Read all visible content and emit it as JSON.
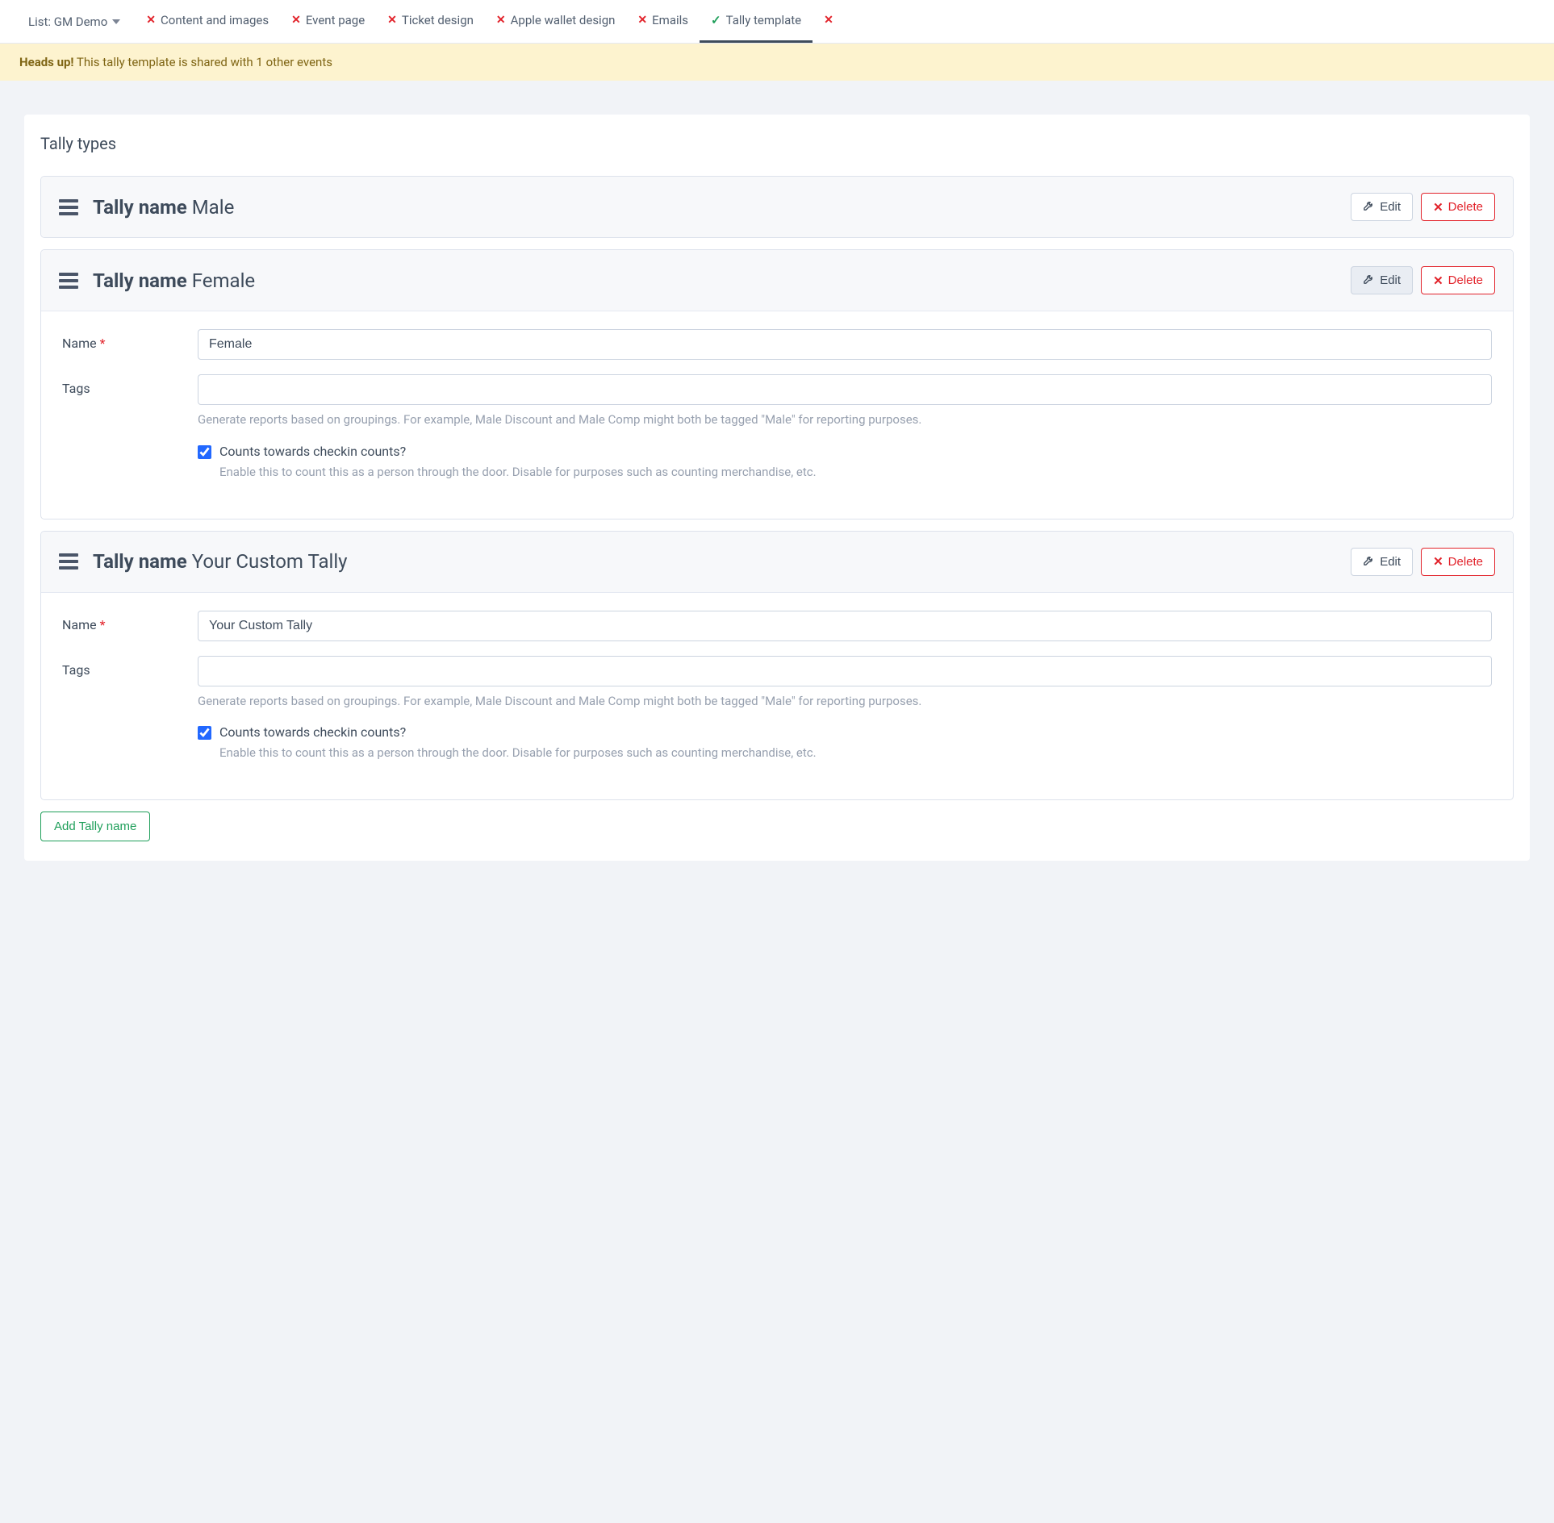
{
  "nav": {
    "list_label": "List: GM Demo",
    "tabs": [
      {
        "label": "Content and images",
        "status": "x",
        "active": false
      },
      {
        "label": "Event page",
        "status": "x",
        "active": false
      },
      {
        "label": "Ticket design",
        "status": "x",
        "active": false
      },
      {
        "label": "Apple wallet design",
        "status": "x",
        "active": false
      },
      {
        "label": "Emails",
        "status": "x",
        "active": false
      },
      {
        "label": "Tally template",
        "status": "check",
        "active": true
      },
      {
        "label": "",
        "status": "x",
        "active": false
      }
    ]
  },
  "alert": {
    "strong": "Heads up!",
    "text": " This tally template is shared with 1 other events"
  },
  "section_title": "Tally types",
  "labels": {
    "tally_name_prefix": "Tally name",
    "edit": "Edit",
    "delete": "Delete",
    "name": "Name",
    "tags": "Tags",
    "req_mark": "*",
    "add_button": "Add Tally name",
    "tags_help": "Generate reports based on groupings. For example, Male Discount and Male Comp might both be tagged \"Male\" for reporting purposes.",
    "checkin_label": "Counts towards checkin counts?",
    "checkin_help": "Enable this to count this as a person through the door. Disable for purposes such as counting merchandise, etc."
  },
  "tallies": [
    {
      "name": "Male",
      "expanded": false,
      "edit_active": false,
      "tags_value": "",
      "checkin": true
    },
    {
      "name": "Female",
      "expanded": true,
      "edit_active": true,
      "tags_value": "",
      "checkin": true
    },
    {
      "name": "Your Custom Tally",
      "expanded": true,
      "edit_active": false,
      "tags_value": "",
      "checkin": true
    }
  ]
}
